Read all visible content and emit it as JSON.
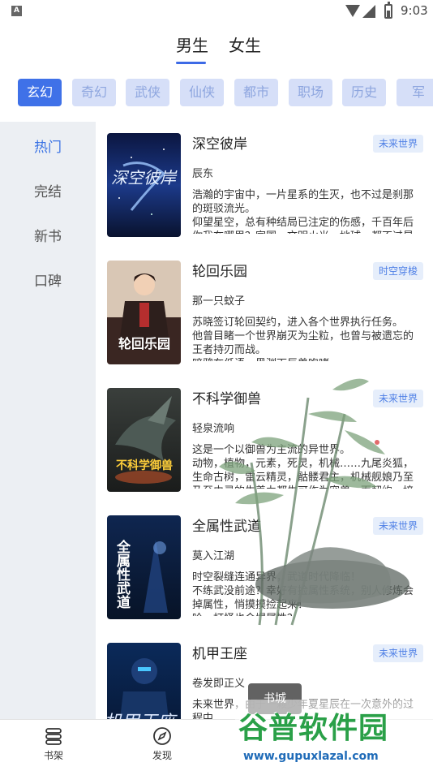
{
  "status_bar": {
    "notification_icon": "A",
    "time": "9:03"
  },
  "gender_tabs": [
    {
      "label": "男生",
      "active": true
    },
    {
      "label": "女生",
      "active": false
    }
  ],
  "genres": [
    {
      "label": "玄幻",
      "active": true
    },
    {
      "label": "奇幻",
      "active": false
    },
    {
      "label": "武侠",
      "active": false
    },
    {
      "label": "仙侠",
      "active": false
    },
    {
      "label": "都市",
      "active": false
    },
    {
      "label": "职场",
      "active": false
    },
    {
      "label": "历史",
      "active": false
    },
    {
      "label": "军",
      "active": false
    }
  ],
  "side_menu": [
    {
      "label": "热门",
      "active": true
    },
    {
      "label": "完结",
      "active": false
    },
    {
      "label": "新书",
      "active": false
    },
    {
      "label": "口碑",
      "active": false
    }
  ],
  "books": [
    {
      "title": "深空彼岸",
      "tag": "未来世界",
      "author": "辰东",
      "description": "浩瀚的宇宙中，一片星系的生灭，也不过是刹那的斑驳流光。\n仰望星空，总有种结局已注定的伤感，千百年后你我在哪里？家国、文明火光、地球，都不过是",
      "cover_text": "深空彼岸"
    },
    {
      "title": "轮回乐园",
      "tag": "时空穿梭",
      "author": "那一只蚊子",
      "description": "苏晓签订轮回契约，进入各个世界执行任务。\n他曾目睹一个世界崩灭为尘粒，也曾与被遗忘的王者持刃而战。\n暗鸦在低语，黑渊下巨兽咆哮",
      "cover_text": "轮回乐园"
    },
    {
      "title": "不科学御兽",
      "tag": "未来世界",
      "author": "轻泉流响",
      "description": "这是一个以御兽为主流的异世界。\n动物，植物，元素，死灵，机械……九尾炎狐，生命古树，雷云精灵，骷髅君主，机械舰娘乃至乃至由灵的生养力都生可作为宠兽，而契约，培",
      "cover_text": "不科学御兽"
    },
    {
      "title": "全属性武道",
      "tag": "未来世界",
      "author": "莫入江湖",
      "description": "时空裂缝连通异界，武道时代降临！\n不练武没前途？幸好有捡属性系统，别人修炼会掉属性，悄摸摸捡起来！\n哈，打怪也会爆属性？",
      "cover_text": "全属性武道"
    },
    {
      "title": "机甲王座",
      "tag": "未来世界",
      "author": "卷发即正义",
      "description": "未来世界，由于一颗少年夏星辰在一次意外的过程中，",
      "cover_text": "机甲王座"
    }
  ],
  "float_button": "书城",
  "bottom_nav": [
    {
      "label": "书架",
      "icon": "bookshelf-icon"
    },
    {
      "label": "发现",
      "icon": "compass-icon"
    }
  ],
  "watermark": {
    "logo_text": "谷普软件园",
    "url": "www.gupuxlazal.com"
  },
  "colors": {
    "accent": "#3f71e8",
    "chip_inactive_bg": "#d6dff8",
    "chip_inactive_text": "#8ea6df",
    "tag_bg": "#e6eefb",
    "tag_text": "#4f80e6",
    "content_bg": "#eceff3"
  }
}
